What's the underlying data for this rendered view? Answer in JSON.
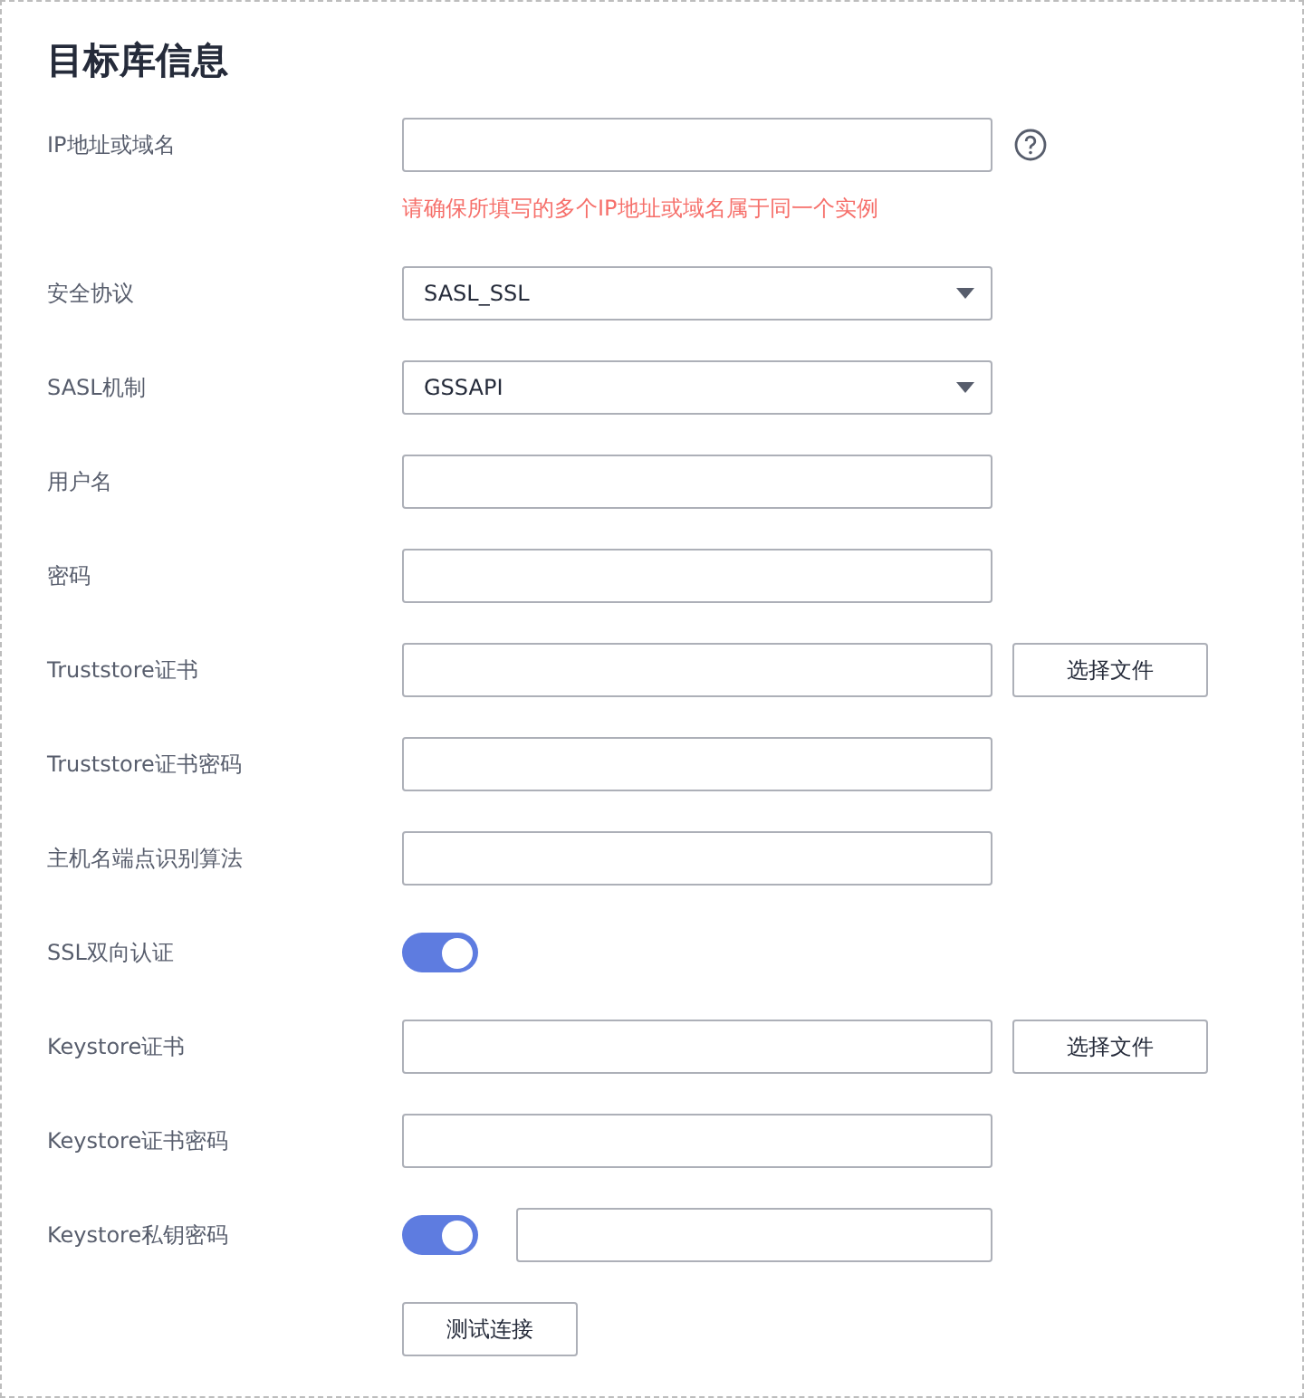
{
  "title": "目标库信息",
  "fields": [
    {
      "kind": "text",
      "label": "IP地址或域名",
      "help": true,
      "hint": "请确保所填写的多个IP地址或域名属于同一个实例"
    },
    {
      "kind": "select",
      "label": "安全协议",
      "value": "SASL_SSL"
    },
    {
      "kind": "select",
      "label": "SASL机制",
      "value": "GSSAPI"
    },
    {
      "kind": "text",
      "label": "用户名"
    },
    {
      "kind": "text",
      "label": "密码"
    },
    {
      "kind": "file",
      "label": "Truststore证书",
      "button": "选择文件"
    },
    {
      "kind": "text",
      "label": "Truststore证书密码"
    },
    {
      "kind": "text",
      "label": "主机名端点识别算法"
    },
    {
      "kind": "toggle",
      "label": "SSL双向认证",
      "on": true
    },
    {
      "kind": "file",
      "label": "Keystore证书",
      "button": "选择文件"
    },
    {
      "kind": "text",
      "label": "Keystore证书密码"
    },
    {
      "kind": "toggle_text",
      "label": "Keystore私钥密码",
      "on": true
    }
  ],
  "test_button": "测试连接"
}
